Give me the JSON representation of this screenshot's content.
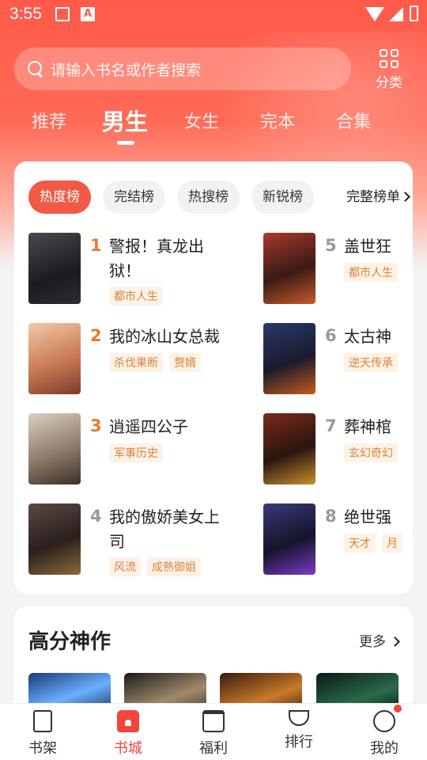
{
  "status_bar": {
    "time": "3:55",
    "badge_letter": "A"
  },
  "search": {
    "placeholder": "请输入书名或作者搜索"
  },
  "category": {
    "label": "分类"
  },
  "tabs": [
    {
      "label": "推荐"
    },
    {
      "label": "男生"
    },
    {
      "label": "女生"
    },
    {
      "label": "完本"
    },
    {
      "label": "合集"
    }
  ],
  "active_tab": "男生",
  "rank_chips": [
    {
      "label": "热度榜"
    },
    {
      "label": "完结榜"
    },
    {
      "label": "热搜榜"
    },
    {
      "label": "新锐榜"
    }
  ],
  "rank_more_label": "完整榜单",
  "books": [
    {
      "rank": "1",
      "title": "警报！真龙出狱！",
      "tags": [
        "都市人生"
      ]
    },
    {
      "rank": "2",
      "title": "我的冰山女总裁",
      "tags": [
        "杀伐果断",
        "赘婿"
      ]
    },
    {
      "rank": "3",
      "title": "逍遥四公子",
      "tags": [
        "军事历史"
      ]
    },
    {
      "rank": "4",
      "title": "我的傲娇美女上司",
      "tags": [
        "风流",
        "成熟御姐"
      ]
    },
    {
      "rank": "5",
      "title": "盖世狂",
      "tags": [
        "都市人生"
      ]
    },
    {
      "rank": "6",
      "title": "太古神",
      "tags": [
        "逆天传承"
      ]
    },
    {
      "rank": "7",
      "title": "葬神棺",
      "tags": [
        "玄幻奇幻"
      ]
    },
    {
      "rank": "8",
      "title": "绝世强",
      "tags": [
        "天才",
        "月"
      ]
    }
  ],
  "high_score": {
    "title": "高分神作",
    "more_label": "更多"
  },
  "bottom_nav": [
    {
      "label": "书架"
    },
    {
      "label": "书城"
    },
    {
      "label": "福利"
    },
    {
      "label": "排行"
    },
    {
      "label": "我的"
    }
  ],
  "colors": {
    "accent": "#f0453a",
    "rank_top": "#e87a2a",
    "tag_text": "#d9833a",
    "tag_bg": "#fdf2e6"
  }
}
